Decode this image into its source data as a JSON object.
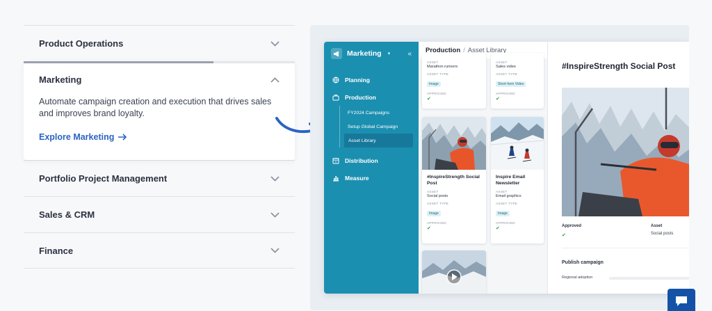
{
  "accordion": {
    "items": [
      {
        "title": "Product Operations",
        "expanded": false
      },
      {
        "title": "Marketing",
        "expanded": true,
        "description": "Automate campaign creation and execution that drives sales and improves brand loyalty.",
        "link_label": "Explore Marketing",
        "progress_percent": 70
      },
      {
        "title": "Portfolio Project Management",
        "expanded": false
      },
      {
        "title": "Sales & CRM",
        "expanded": false
      },
      {
        "title": "Finance",
        "expanded": false
      }
    ]
  },
  "app": {
    "sidebar": {
      "brand": "Marketing",
      "nav": [
        {
          "label": "Planning",
          "icon": "globe-icon"
        },
        {
          "label": "Production",
          "icon": "briefcase-icon"
        },
        {
          "label": "Distribution",
          "icon": "calendar-icon"
        },
        {
          "label": "Measure",
          "icon": "bar-chart-icon"
        }
      ],
      "sub_items": [
        {
          "label": "FY2024 Campaigns",
          "active": false
        },
        {
          "label": "Setup Global Campaign",
          "active": false
        },
        {
          "label": "Asset Library",
          "active": true
        }
      ]
    },
    "breadcrumb": {
      "section": "Production",
      "separator": "/",
      "page": "Asset Library"
    },
    "cards": [
      {
        "asset_label": "ASSET",
        "asset": "Marathon runners",
        "type_label": "ASSET TYPE",
        "type": "Image",
        "approved_label": "APPROVED"
      },
      {
        "asset_label": "ASSET",
        "asset": "Sales video",
        "type_label": "ASSET TYPE",
        "type": "Short form Video",
        "approved_label": "APPROVED"
      },
      {
        "title": "#InspireStrength Social Post",
        "asset_label": "ASSET",
        "asset": "Social posts",
        "type_label": "ASSET TYPE",
        "type": "Image",
        "approved_label": "APPROVED"
      },
      {
        "title": "Inspire Email Newsletter",
        "asset_label": "ASSET",
        "asset": "Email graphics",
        "type_label": "ASSET TYPE",
        "type": "Image",
        "approved_label": "APPROVED"
      }
    ],
    "detail": {
      "title": "#InspireStrength Social Post",
      "approved_label": "Approved",
      "asset_label": "Asset",
      "asset_value": "Social posts",
      "publish_label": "Publish campaign",
      "regional_label": "Regional adoption"
    }
  },
  "colors": {
    "sidebar": "#1b8fb0",
    "link": "#2b63c6",
    "arrow": "#2b63c6",
    "chat": "#1452a8",
    "check": "#2e9b4e"
  }
}
